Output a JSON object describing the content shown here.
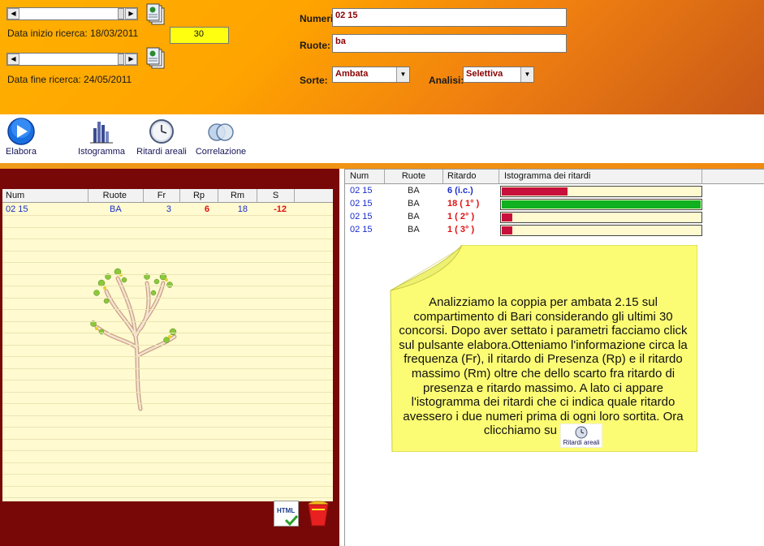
{
  "search": {
    "start_label": "Data inizio ricerca: 18/03/2011",
    "end_label": "Data fine ricerca: 24/05/2011",
    "count_value": "30",
    "numbers_label": "Numeri:",
    "numbers_value": "02 15",
    "wheels_label": "Ruote:",
    "wheels_value": "ba",
    "sorte_label": "Sorte:",
    "sorte_value": "Ambata",
    "analisi_label": "Analisi:",
    "analisi_value": "Selettiva"
  },
  "toolbar": {
    "elabora": "Elabora",
    "istogramma": "Istogramma",
    "ritardi": "Ritardi areali",
    "correlazione": "Correlazione"
  },
  "left_table": {
    "headers": [
      "Num",
      "Ruote",
      "Fr",
      "Rp",
      "Rm",
      "S"
    ],
    "row": {
      "num": "02 15",
      "ruote": "BA",
      "fr": "3",
      "rp": "6",
      "rm": "18",
      "s": "-12"
    }
  },
  "right_table": {
    "headers": [
      "Num",
      "Ruote",
      "Ritardo",
      "Istogramma dei ritardi"
    ],
    "rows": [
      {
        "num": "02 15",
        "ruote": "BA",
        "ritardo": "6   (i.c.)",
        "fill": 0.33,
        "color": "#c8103c"
      },
      {
        "num": "02 15",
        "ruote": "BA",
        "ritardo": "18   ( 1° )",
        "fill": 1.0,
        "color": "#10b020"
      },
      {
        "num": "02 15",
        "ruote": "BA",
        "ritardo": "1   ( 2° )",
        "fill": 0.055,
        "color": "#c8103c"
      },
      {
        "num": "02 15",
        "ruote": "BA",
        "ritardo": "1   ( 3° )",
        "fill": 0.055,
        "color": "#c8103c"
      }
    ]
  },
  "note": {
    "text": "Analizziamo la coppia per ambata 2.15 sul compartimento di Bari considerando gli ultimi 30 concorsi. Dopo aver settato i parametri facciamo click sul pulsante elabora.Otteniamo l'informazione circa la frequenza (Fr), il ritardo di Presenza (Rp) e il ritardo massimo (Rm) oltre che dello scarto fra ritardo di presenza e ritardo massimo. A lato ci appare l'istogramma dei ritardi che ci indica quale ritardo avessero i due numeri prima di ogni loro sortita. Ora clicchiamo su",
    "inline_button_label": "Ritardi areali"
  },
  "icons": {
    "export_html": "HTML"
  }
}
